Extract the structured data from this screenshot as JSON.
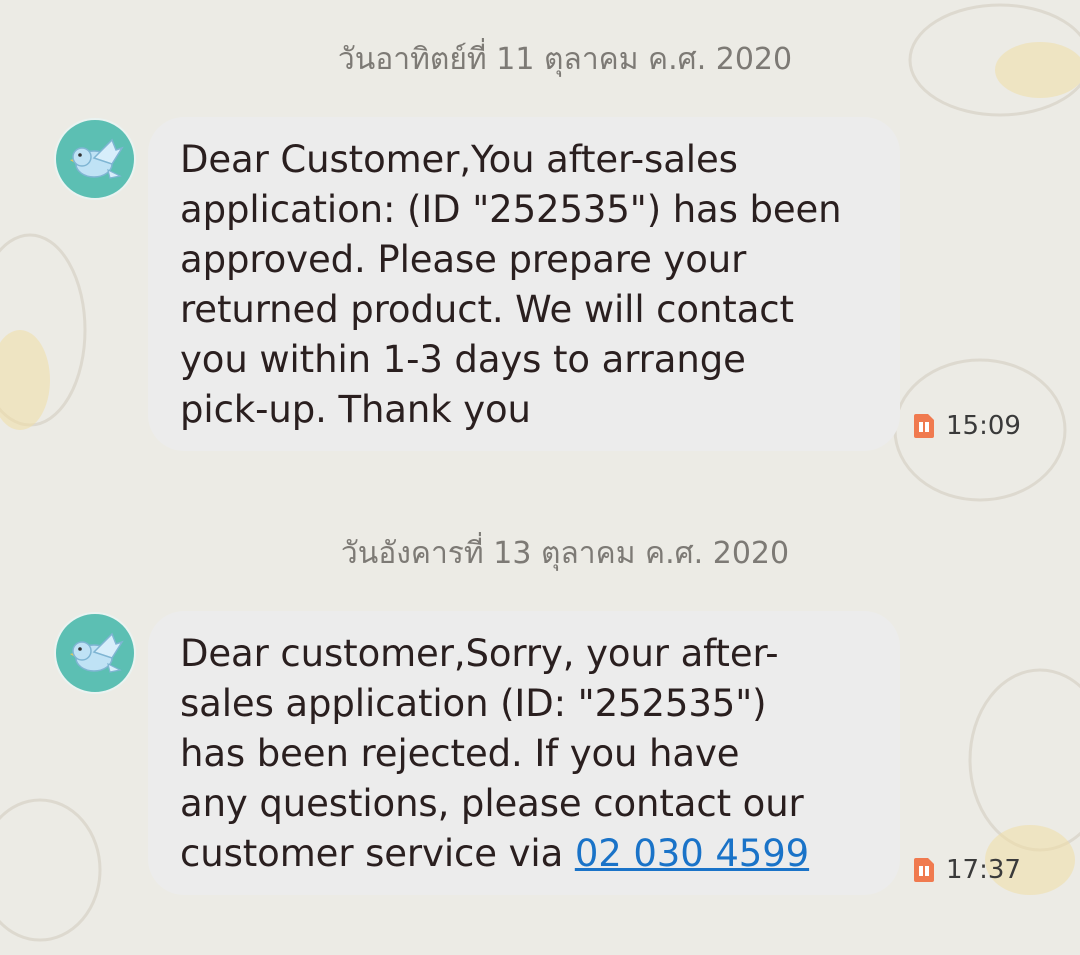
{
  "conversation": {
    "groups": [
      {
        "date": "วันอาทิตย์ที่ 11 ตุลาคม ค.ศ. 2020",
        "message": {
          "lines": [
            "Dear Customer,You after-sales",
            "application: (ID \"252535\") has been",
            "approved. Please prepare your",
            "returned product. We will contact",
            "you within 1-3 days to arrange",
            "pick-up. Thank you"
          ],
          "time": "15:09",
          "sim_icon": "sim-card-icon"
        }
      },
      {
        "date": "วันอังคารที่ 13 ตุลาคม ค.ศ. 2020",
        "message": {
          "lines": [
            "Dear customer,Sorry, your after-",
            "sales application (ID: \"252535\")",
            "has been rejected. If you have",
            "any questions, please contact our",
            "customer service via "
          ],
          "link": "02 030 4599",
          "time": "17:37",
          "sim_icon": "sim-card-icon"
        }
      }
    ]
  },
  "avatar_icon": "bird-icon",
  "colors": {
    "background": "#ecebe5",
    "bubble": "#ececec",
    "avatar": "#5cbfb3",
    "link": "#1a73c8",
    "sim_icon": "#f07a4f",
    "date_text": "#7d7a75"
  }
}
